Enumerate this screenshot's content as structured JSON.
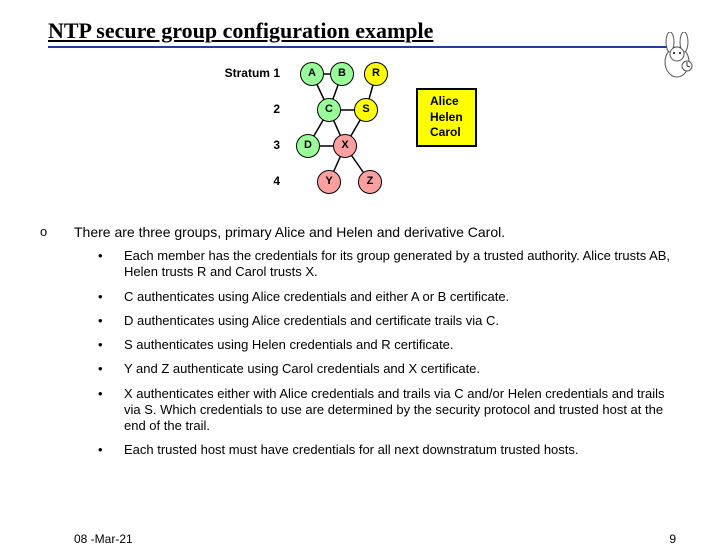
{
  "title": "NTP secure group configuration example",
  "diagram": {
    "row_labels": {
      "r1": "Stratum 1",
      "r2": "2",
      "r3": "3",
      "r4": "4"
    },
    "nodes": {
      "A": {
        "label": "A",
        "fill": "#99ff99"
      },
      "B": {
        "label": "B",
        "fill": "#99ff99"
      },
      "R": {
        "label": "R",
        "fill": "#ffff00"
      },
      "C": {
        "label": "C",
        "fill": "#99ff99"
      },
      "S": {
        "label": "S",
        "fill": "#ffff00"
      },
      "D": {
        "label": "D",
        "fill": "#99ff99"
      },
      "X": {
        "label": "X",
        "fill": "#ffa0a0"
      },
      "Y": {
        "label": "Y",
        "fill": "#ffa0a0"
      },
      "Z": {
        "label": "Z",
        "fill": "#ffa0a0"
      }
    },
    "legend": {
      "g1": "Alice",
      "g2": "Helen",
      "g3": "Carol"
    }
  },
  "intro": "There are three groups, primary Alice and Helen and derivative Carol.",
  "bullets": [
    "Each member has the credentials for its group generated by a trusted authority. Alice trusts AB, Helen trusts R and Carol trusts X.",
    "C authenticates using Alice credentials and either A or B certificate.",
    "D authenticates using Alice credentials and certificate trails via C.",
    "S authenticates using Helen credentials and R certificate.",
    "Y and Z authenticate using Carol credentials and X certificate.",
    "X authenticates either with Alice credentials and trails via C and/or Helen credentials and trails via S. Which credentials to use are determined by the security protocol and trusted host at the end of the trail.",
    "Each trusted host must have credentials for all next downstratum trusted hosts."
  ],
  "footer": {
    "date": "08 -Mar-21",
    "page": "9"
  },
  "marks": {
    "o": "o",
    "bullet": "•"
  }
}
